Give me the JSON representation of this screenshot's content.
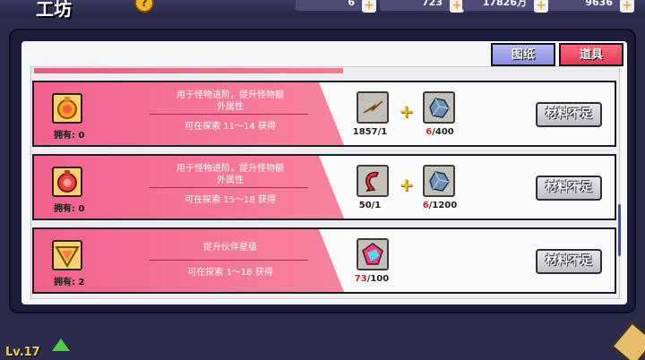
{
  "header": {
    "title": "工坊",
    "help": "?",
    "resources": [
      {
        "value": "6"
      },
      {
        "value": "723"
      },
      {
        "value": "17826万"
      },
      {
        "value": "9636"
      }
    ]
  },
  "tabs": [
    {
      "label": "图纸"
    },
    {
      "label": "道具"
    }
  ],
  "items": [
    {
      "owned_label": "拥有: 0",
      "desc_line1": "用于怪物进阶，提升怪物额",
      "desc_line2": "外属性",
      "source": "可在探索 11～14 获得",
      "mat1_count": "1857/1",
      "mat2_have": "6",
      "mat2_need": "/400",
      "button": "材料不足"
    },
    {
      "owned_label": "拥有: 0",
      "desc_line1": "用于怪物进阶，提升怪物额",
      "desc_line2": "外属性",
      "source": "可在探索 15～18 获得",
      "mat1_count": "50/1",
      "mat2_have": "6",
      "mat2_need": "/1200",
      "button": "材料不足"
    },
    {
      "owned_label": "拥有: 2",
      "desc_line1": "提升伙伴星级",
      "source": "可在探索 1～18 获得",
      "mat1_have": "73",
      "mat1_need": "/100",
      "button": "材料不足"
    }
  ],
  "player": {
    "level": "Lv.17"
  },
  "colors": {
    "accent_pink": "#f1628d",
    "tab_blue": "#8a8ce0",
    "tab_red": "#e23a55"
  }
}
